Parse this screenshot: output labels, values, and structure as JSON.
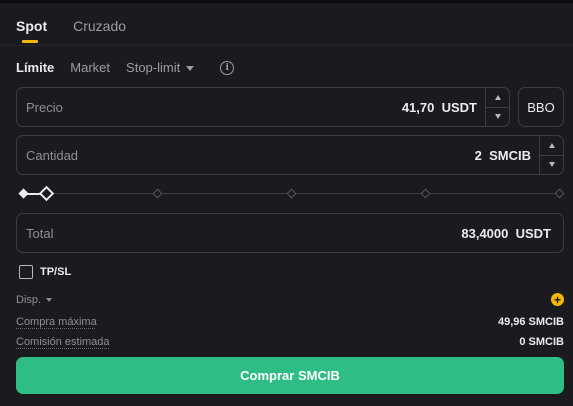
{
  "tabs": [
    {
      "label": "Spot",
      "active": true
    },
    {
      "label": "Cruzado",
      "active": false
    }
  ],
  "order_types": {
    "limit": "Límite",
    "market": "Market",
    "stop_limit": "Stop-limit"
  },
  "price": {
    "label": "Precio",
    "value": "41,70",
    "unit": "USDT"
  },
  "bbo_label": "BBO",
  "quantity": {
    "label": "Cantidad",
    "value": "2",
    "unit": "SMCIB"
  },
  "slider": {
    "percent": 4
  },
  "total": {
    "label": "Total",
    "value": "83,4000",
    "unit": "USDT"
  },
  "tpsl_label": "TP/SL",
  "info": {
    "available_label": "Disp.",
    "max_buy_label": "Compra máxima",
    "max_buy_value": "49,96 SMCIB",
    "fee_label": "Comisión estimada",
    "fee_value": "0 SMCIB"
  },
  "buy_button_label": "Comprar SMCIB",
  "colors": {
    "accent": "#f0b90b",
    "buy": "#2ebd85",
    "background": "#1b1b1f"
  }
}
